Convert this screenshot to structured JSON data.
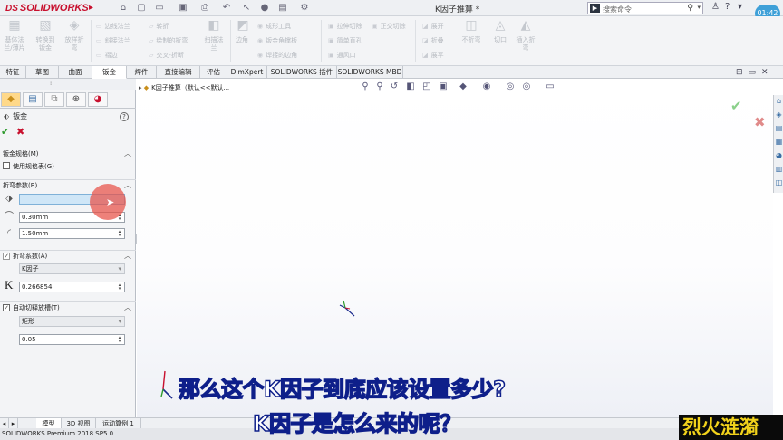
{
  "app": {
    "brand": "SOLIDWORKS",
    "brand_prefix": "DS",
    "document_title": "K因子推算 *",
    "search_placeholder": "搜索命令",
    "clock": "01:42"
  },
  "ribbon": {
    "big_buttons": [
      {
        "label": "基体法\n兰/薄片",
        "icon": "base-flange-icon"
      },
      {
        "label": "转换到\n钣金",
        "icon": "convert-to-sheet-metal-icon"
      },
      {
        "label": "放样折\n弯",
        "icon": "lofted-bend-icon"
      },
      {
        "label": "扫描法\n兰",
        "icon": "swept-flange-icon"
      },
      {
        "label": "边角",
        "icon": "corners-icon"
      },
      {
        "label": "展开",
        "icon": "unfold-icon"
      },
      {
        "label": "不折弯",
        "icon": "no-bends-icon"
      },
      {
        "label": "切口",
        "icon": "rip-icon"
      },
      {
        "label": "插入折\n弯",
        "icon": "insert-bends-icon"
      }
    ],
    "small_buttons": [
      {
        "label": "边线法兰",
        "icon": "edge-flange-icon"
      },
      {
        "label": "斜接法兰",
        "icon": "miter-flange-icon"
      },
      {
        "label": "褶边",
        "icon": "hem-icon"
      },
      {
        "label": "转折",
        "icon": "jog-icon"
      },
      {
        "label": "绘制的折弯",
        "icon": "sketched-bend-icon"
      },
      {
        "label": "交叉-折断",
        "icon": "cross-break-icon"
      },
      {
        "label": "成形工具",
        "icon": "forming-tool-icon"
      },
      {
        "label": "钣金角撑板",
        "icon": "sheet-metal-gusset-icon"
      },
      {
        "label": "焊接的边角",
        "icon": "welded-corner-icon"
      },
      {
        "label": "拉伸切除",
        "icon": "extruded-cut-icon"
      },
      {
        "label": "简单直孔",
        "icon": "simple-hole-icon"
      },
      {
        "label": "通风口",
        "icon": "vent-icon"
      },
      {
        "label": "正交切除",
        "icon": "normal-cut-icon"
      },
      {
        "label": "展开",
        "icon": "unfold-small-icon"
      },
      {
        "label": "折叠",
        "icon": "fold-icon"
      },
      {
        "label": "展平",
        "icon": "flatten-icon"
      }
    ]
  },
  "tabs": [
    {
      "label": "特征",
      "active": false
    },
    {
      "label": "草图",
      "active": false
    },
    {
      "label": "曲面",
      "active": false
    },
    {
      "label": "钣金",
      "active": true
    },
    {
      "label": "焊件",
      "active": false
    },
    {
      "label": "直接编辑",
      "active": false
    },
    {
      "label": "评估",
      "active": false
    },
    {
      "label": "DimXpert",
      "active": false
    },
    {
      "label": "SOLIDWORKS 插件",
      "active": false
    },
    {
      "label": "SOLIDWORKS MBD",
      "active": false
    }
  ],
  "property_manager": {
    "title": "钣金",
    "ok_icon": "checkmark-icon",
    "cancel_icon": "close-icon",
    "sections": {
      "gauge": {
        "title": "钣金规格(M)",
        "use_gauge_table": "使用规格表(G)",
        "use_gauge_table_checked": false
      },
      "bend_params": {
        "title": "折弯参数(B)",
        "selection_value": "",
        "thickness": "0.30mm",
        "radius": "1.50mm"
      },
      "bend_allowance": {
        "title": "折弯系数(A)",
        "checked": true,
        "type": "K因子",
        "k_letter": "K",
        "k_value": "0.266854"
      },
      "auto_relief": {
        "title": "自动切释放槽(T)",
        "checked": true,
        "type": "矩形",
        "ratio": "0.05"
      }
    }
  },
  "graphics": {
    "tree_crumb": "K因子推算（默认<<默认...",
    "accent_green": "#2e9a2e",
    "accent_red": "#c8102e"
  },
  "bottom_tabs": [
    {
      "label": "模型",
      "active": true
    },
    {
      "label": "3D 视图",
      "active": false
    },
    {
      "label": "运动算例 1",
      "active": false
    }
  ],
  "status": "SOLIDWORKS Premium 2018 SP5.0",
  "subtitles": {
    "line1": "那么这个K因子到底应该设置多少?",
    "line2": "K因子是怎么来的呢？",
    "watermark": "烈火涟漪"
  }
}
